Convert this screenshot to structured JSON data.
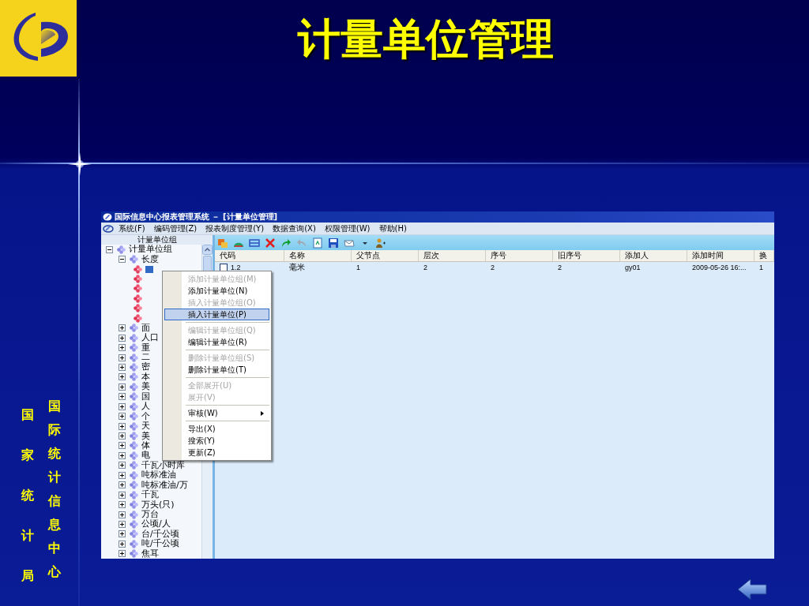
{
  "slide": {
    "title": "计量单位管理",
    "side_text": [
      "国家统计局",
      "国际统计信息中心"
    ]
  },
  "window": {
    "title": "国际信息中心报表管理系统 － [计量单位管理]",
    "menu": [
      "系统(F)",
      "编码管理(Z)",
      "报表制度管理(Y)",
      "数据查询(X)",
      "权限管理(W)",
      "帮助(H)"
    ],
    "tree_header": "计量单位组",
    "tree": [
      {
        "label": "计量单位组",
        "kind": "group",
        "expanded": true,
        "selected": false,
        "children": [
          {
            "label": "长度",
            "kind": "group",
            "expanded": true,
            "selected": false,
            "children": [
              {
                "kind": "unit",
                "selected": true
              },
              {
                "kind": "unit",
                "selected": false
              },
              {
                "kind": "unit",
                "selected": false
              },
              {
                "kind": "unit",
                "selected": false
              },
              {
                "kind": "unit",
                "selected": false
              },
              {
                "kind": "unit",
                "selected": false
              }
            ]
          },
          {
            "label": "面",
            "kind": "group",
            "expanded": false,
            "selected": false
          },
          {
            "label": "人口",
            "kind": "group",
            "expanded": false,
            "selected": false
          },
          {
            "label": "重",
            "kind": "group",
            "expanded": false,
            "selected": false
          },
          {
            "label": "二",
            "kind": "group",
            "expanded": false,
            "selected": false
          },
          {
            "label": "密",
            "kind": "group",
            "expanded": false,
            "selected": false
          },
          {
            "label": "本",
            "kind": "group",
            "expanded": false,
            "selected": false
          },
          {
            "label": "美",
            "kind": "group",
            "expanded": false,
            "selected": false
          },
          {
            "label": "国",
            "kind": "group",
            "expanded": false,
            "selected": false
          },
          {
            "label": "人",
            "kind": "group",
            "expanded": false,
            "selected": false
          },
          {
            "label": "个",
            "kind": "group",
            "expanded": false,
            "selected": false
          },
          {
            "label": "天",
            "kind": "group",
            "expanded": false,
            "selected": false
          },
          {
            "label": "美",
            "kind": "group",
            "expanded": false,
            "selected": false
          },
          {
            "label": "体",
            "kind": "group",
            "expanded": false,
            "selected": false
          },
          {
            "label": "电",
            "kind": "group",
            "expanded": false,
            "selected": false
          },
          {
            "label": "千瓦小时库",
            "kind": "group",
            "expanded": false,
            "selected": false
          },
          {
            "label": "吨标准油",
            "kind": "group",
            "expanded": false,
            "selected": false
          },
          {
            "label": "吨标准油/万",
            "kind": "group",
            "expanded": false,
            "selected": false
          },
          {
            "label": "千瓦",
            "kind": "group",
            "expanded": false,
            "selected": false
          },
          {
            "label": "万头(只)",
            "kind": "group",
            "expanded": false,
            "selected": false
          },
          {
            "label": "万台",
            "kind": "group",
            "expanded": false,
            "selected": false
          },
          {
            "label": "公顷/人",
            "kind": "group",
            "expanded": false,
            "selected": false
          },
          {
            "label": "台/千公顷",
            "kind": "group",
            "expanded": false,
            "selected": false
          },
          {
            "label": "吨/千公顷",
            "kind": "group",
            "expanded": false,
            "selected": false
          },
          {
            "label": "焦耳",
            "kind": "group",
            "expanded": false,
            "selected": false
          }
        ]
      }
    ],
    "table": {
      "columns": [
        "代码",
        "名称",
        "父节点",
        "层次",
        "序号",
        "旧序号",
        "添加人",
        "添加时间",
        "换"
      ],
      "rows": [
        {
          "checked": false,
          "selected": false,
          "cells": [
            "1.2",
            "毫米",
            "1",
            "2",
            "2",
            "2",
            "gy01",
            "2009-05-26 16:...",
            "1"
          ]
        }
      ]
    },
    "context_menu": [
      {
        "kind": "item",
        "label": "添加计量单位组(M)",
        "disabled": true,
        "selected": false
      },
      {
        "kind": "item",
        "label": "添加计量单位(N)",
        "disabled": false,
        "selected": false
      },
      {
        "kind": "item",
        "label": "插入计量单位组(O)",
        "disabled": true,
        "selected": false
      },
      {
        "kind": "item",
        "label": "插入计量单位(P)",
        "disabled": false,
        "selected": true
      },
      {
        "kind": "separator"
      },
      {
        "kind": "item",
        "label": "编辑计量单位组(Q)",
        "disabled": true,
        "selected": false
      },
      {
        "kind": "item",
        "label": "编辑计量单位(R)",
        "disabled": false,
        "selected": false
      },
      {
        "kind": "separator"
      },
      {
        "kind": "item",
        "label": "删除计量单位组(S)",
        "disabled": true,
        "selected": false
      },
      {
        "kind": "item",
        "label": "删除计量单位(T)",
        "disabled": false,
        "selected": false
      },
      {
        "kind": "separator"
      },
      {
        "kind": "item",
        "label": "全部展开(U)",
        "disabled": true,
        "selected": false
      },
      {
        "kind": "item",
        "label": "展开(V)",
        "disabled": true,
        "selected": false
      },
      {
        "kind": "separator"
      },
      {
        "kind": "submenu",
        "label": "审核(W)",
        "disabled": false,
        "selected": false
      },
      {
        "kind": "separator"
      },
      {
        "kind": "item",
        "label": "导出(X)",
        "disabled": false,
        "selected": false
      },
      {
        "kind": "item",
        "label": "搜索(Y)",
        "disabled": false,
        "selected": false
      },
      {
        "kind": "item",
        "label": "更新(Z)",
        "disabled": false,
        "selected": false
      }
    ]
  }
}
